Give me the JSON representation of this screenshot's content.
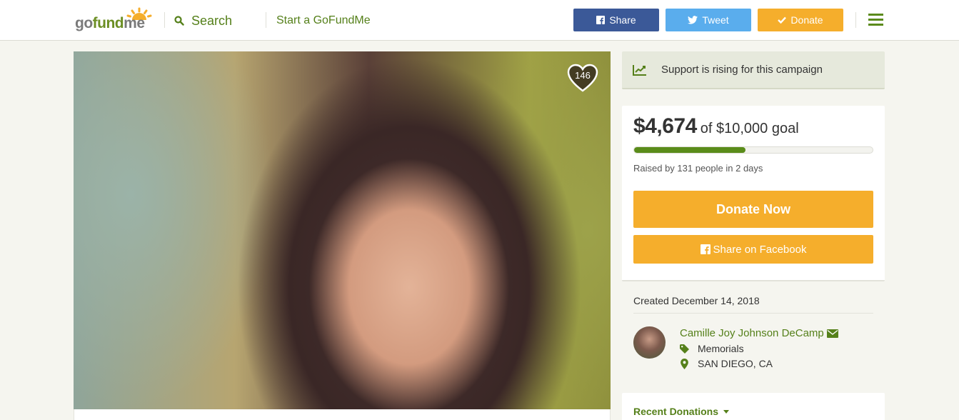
{
  "header": {
    "logo_text_go": "go",
    "logo_text_fund": "fund",
    "logo_text_me": "me",
    "search_label": "Search",
    "start_label": "Start a GoFundMe",
    "share_label": "Share",
    "tweet_label": "Tweet",
    "donate_label": "Donate"
  },
  "photo": {
    "heart_count": "146"
  },
  "sidebar": {
    "rising_text": "Support is rising for this campaign",
    "raised_amount": "$4,674",
    "goal_text": "of $10,000 goal",
    "progress_fraction": 0.4674,
    "raised_by": "Raised by 131 people in 2 days",
    "donate_now_label": "Donate Now",
    "share_facebook_label": "Share on Facebook",
    "created": "Created December 14, 2018",
    "organizer_name": "Camille Joy Johnson DeCamp",
    "category": "Memorials",
    "location": "SAN DIEGO, CA",
    "recent_donations_label": "Recent Donations"
  },
  "colors": {
    "brand_green": "#55801a",
    "donate_orange": "#f5ae2c",
    "facebook_blue": "#3b5998",
    "twitter_blue": "#5aaded"
  }
}
